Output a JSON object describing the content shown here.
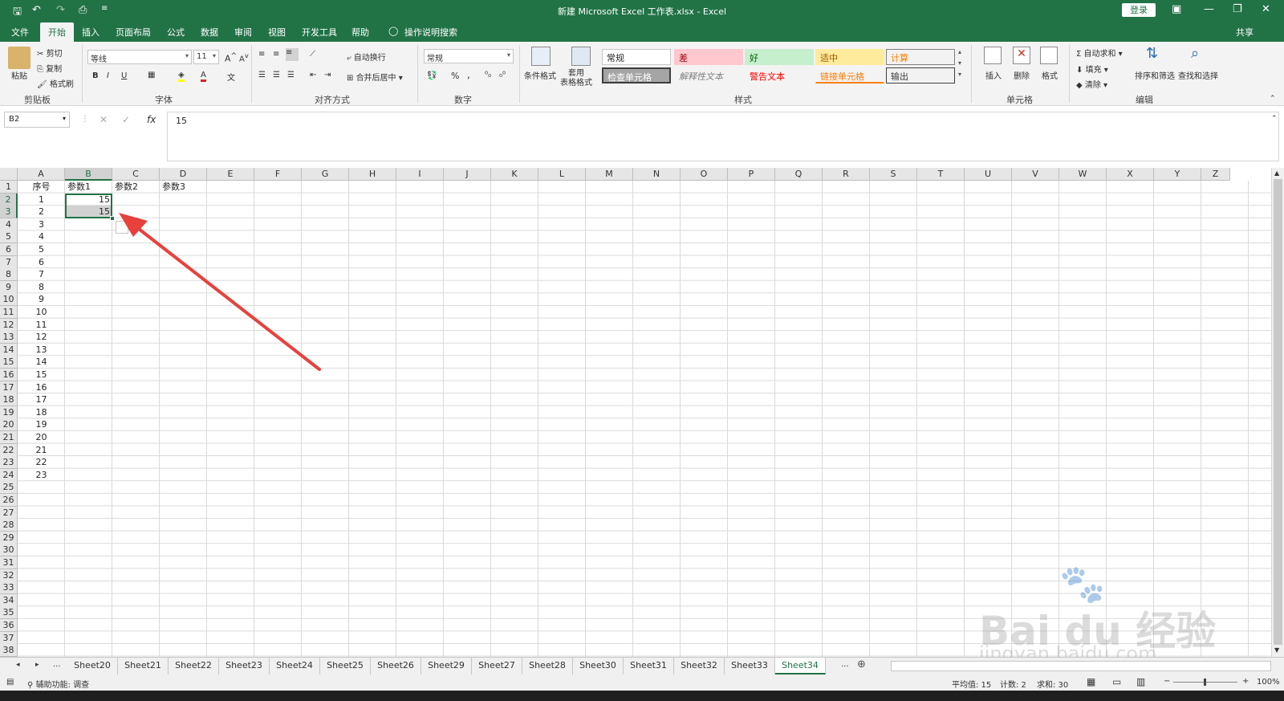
{
  "title": "新建 Microsoft Excel 工作表.xlsx  -  Excel",
  "login": "登录",
  "tabs": [
    "文件",
    "开始",
    "插入",
    "页面布局",
    "公式",
    "数据",
    "审阅",
    "视图",
    "开发工具",
    "帮助",
    "操作说明搜索"
  ],
  "share": "共享",
  "ribbon": {
    "clipboard": {
      "paste": "粘贴",
      "cut": "剪切",
      "copy": "复制",
      "format_painter": "格式刷",
      "label": "剪贴板"
    },
    "font": {
      "name": "等线",
      "size": "11",
      "label": "字体"
    },
    "align": {
      "wrap": "自动换行",
      "merge": "合并后居中",
      "label": "对齐方式"
    },
    "number": {
      "format": "常规",
      "percent": "%",
      "comma": ",",
      "label": "数字"
    },
    "styles": {
      "cond": "条件格式",
      "table": "套用\n表格格式",
      "normal": "常规",
      "bad": "差",
      "good": "好",
      "neutral": "适中",
      "calc": "计算",
      "check": "检查单元格",
      "explain": "解释性文本",
      "warn": "警告文本",
      "link": "链接单元格",
      "output": "输出",
      "label": "样式"
    },
    "cells": {
      "insert": "插入",
      "delete": "删除",
      "format": "格式",
      "label": "单元格"
    },
    "edit": {
      "autosum": "自动求和",
      "fill": "填充",
      "clear": "清除",
      "sort": "排序和筛选",
      "find": "查找和选择",
      "label": "编辑"
    }
  },
  "namebox": "B2",
  "formula": "15",
  "columns": [
    "A",
    "B",
    "C",
    "D",
    "E",
    "F",
    "G",
    "H",
    "I",
    "J",
    "K",
    "L",
    "M",
    "N",
    "O",
    "P",
    "Q",
    "R",
    "S",
    "T",
    "U",
    "V",
    "W",
    "X",
    "Y",
    "Z"
  ],
  "rows": [
    "1",
    "2",
    "3",
    "4",
    "5",
    "6",
    "7",
    "8",
    "9",
    "10",
    "11",
    "12",
    "13",
    "14",
    "15",
    "16",
    "17",
    "18",
    "19",
    "20",
    "21",
    "22",
    "23",
    "24",
    "25",
    "26",
    "27",
    "28",
    "29",
    "30",
    "31",
    "32",
    "33",
    "34",
    "35",
    "36",
    "37",
    "38"
  ],
  "header_cells": {
    "A1": "序号",
    "B1": "参数1",
    "C1": "参数2",
    "D1": "参数3"
  },
  "col_a_values": [
    "1",
    "2",
    "3",
    "4",
    "5",
    "6",
    "7",
    "8",
    "9",
    "10",
    "11",
    "12",
    "13",
    "14",
    "15",
    "16",
    "17",
    "18",
    "19",
    "20",
    "21",
    "22",
    "23"
  ],
  "b_values": {
    "B2": "15",
    "B3": "15"
  },
  "sheets": [
    "Sheet20",
    "Sheet21",
    "Sheet22",
    "Sheet23",
    "Sheet24",
    "Sheet25",
    "Sheet26",
    "Sheet29",
    "Sheet27",
    "Sheet28",
    "Sheet30",
    "Sheet31",
    "Sheet32",
    "Sheet33",
    "Sheet34"
  ],
  "status": {
    "accessibility": "辅助功能: 调查",
    "average": "平均值: 15",
    "count": "计数: 2",
    "sum": "求和: 30",
    "zoom": "100%"
  },
  "watermark": {
    "brand": "Bai du 经验",
    "url": "jingyan.baidu.com"
  },
  "colors": {
    "excel_green": "#217346",
    "arrow": "#e8413c"
  }
}
